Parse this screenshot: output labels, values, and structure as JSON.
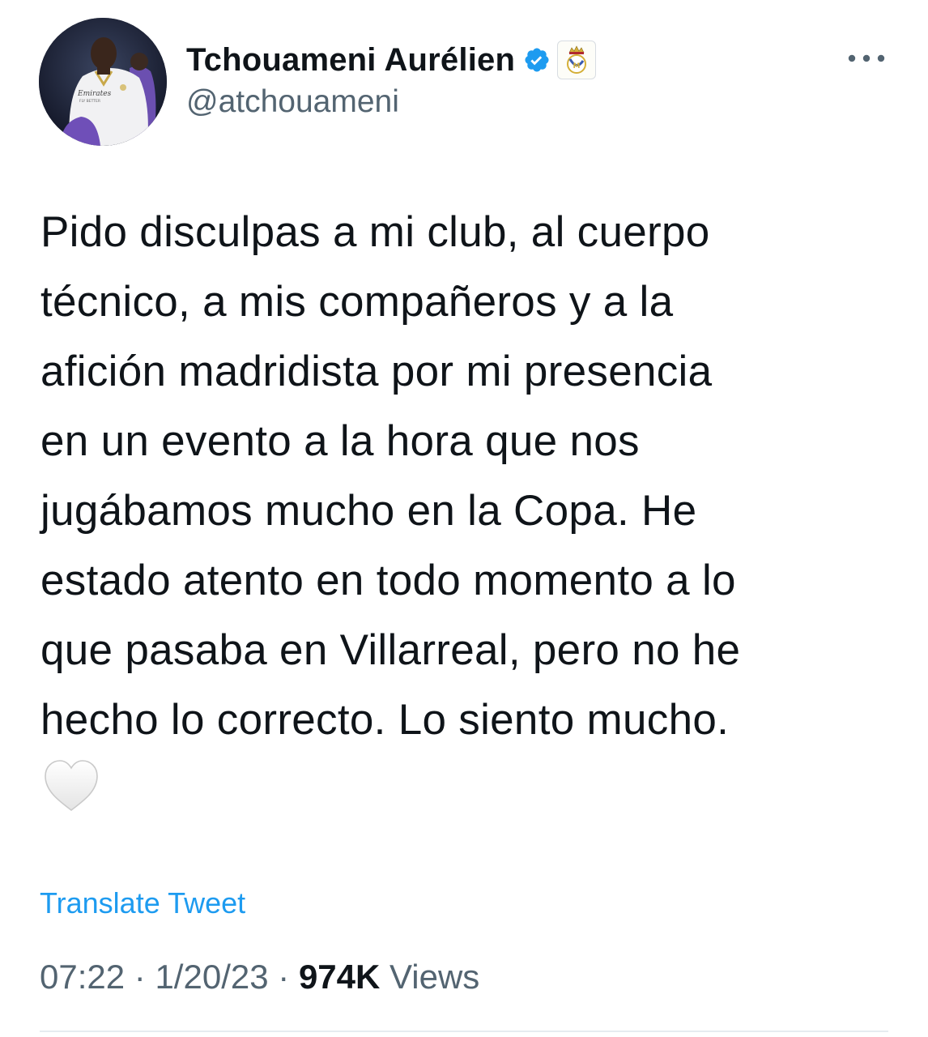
{
  "author": {
    "display_name": "Tchouameni Aurélien",
    "handle": "@atchouameni",
    "verified": true,
    "affiliation_badge": "real-madrid-crest-icon",
    "avatar_jersey_text": "Emirates",
    "avatar_jersey_subtext": "FLY BETTER"
  },
  "tweet": {
    "text": "Pido disculpas a mi club, al cuerpo\ntécnico, a mis compañeros y a la\nafición madridista por mi presencia\nen un evento a la hora que nos\njugábamos mucho en la Copa. He\nestado atento en todo momento a lo\nque pasaba en Villarreal, pero no he\nhecho lo correcto. Lo siento mucho.",
    "emoji": "white-heart-icon",
    "translate_label": "Translate Tweet",
    "time": "07:22",
    "date": "1/20/23",
    "separator": "·",
    "views_count": "974K",
    "views_label": "Views"
  },
  "colors": {
    "accent": "#1d9bf0",
    "secondary_text": "#536471",
    "primary_text": "#0f1419",
    "verified_badge": "#1d9bf0"
  },
  "icons": {
    "more": "more-options-icon",
    "verified": "verified-badge-icon"
  }
}
